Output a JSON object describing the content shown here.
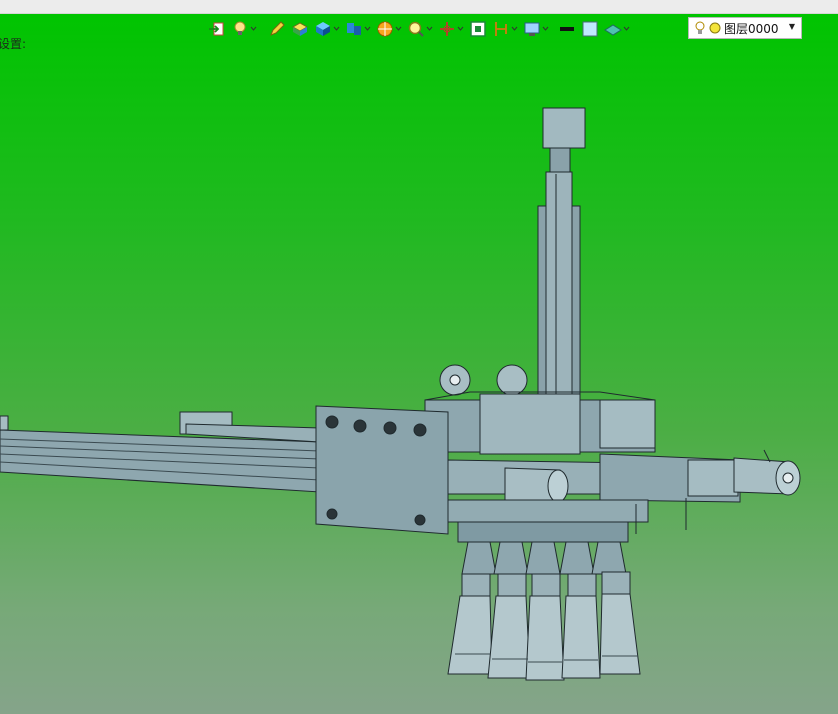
{
  "left_panel": {
    "label": "设置:"
  },
  "toolbar": {
    "layer_selector": {
      "value": "图层0000"
    },
    "icons": [
      "import-icon",
      "light-icon",
      "pen-icon",
      "solid-yellow-icon",
      "cube-icon",
      "multi-view-icon",
      "render-sphere-icon",
      "zoom-icon",
      "axis-icon",
      "fit-view-icon",
      "section-icon",
      "display-icon",
      "line-width-icon",
      "color-icon",
      "surface-icon"
    ]
  },
  "colors": {
    "viewport_top": "#00c400",
    "viewport_bottom": "#85a48a",
    "model_fill": "#7f9aa3",
    "model_stroke": "#1f2a2e"
  }
}
